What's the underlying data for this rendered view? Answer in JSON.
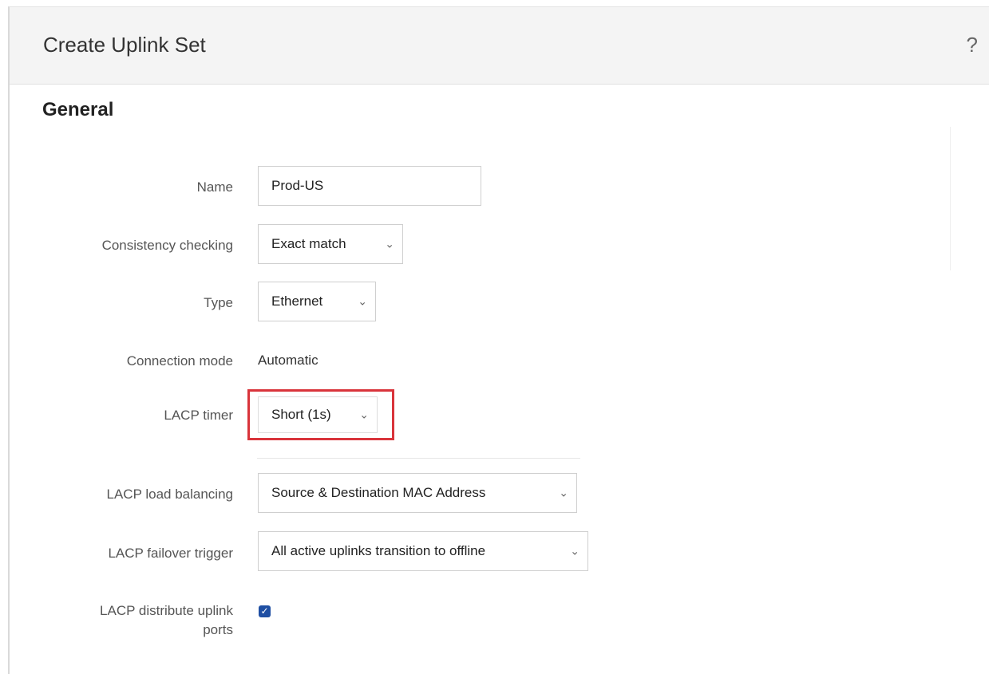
{
  "dialog": {
    "title": "Create Uplink Set",
    "help_label": "?"
  },
  "section": {
    "title": "General"
  },
  "form": {
    "name": {
      "label": "Name",
      "value": "Prod-US"
    },
    "consistency_checking": {
      "label": "Consistency checking",
      "value": "Exact match"
    },
    "type": {
      "label": "Type",
      "value": "Ethernet"
    },
    "connection_mode": {
      "label": "Connection mode",
      "value": "Automatic"
    },
    "lacp_timer": {
      "label": "LACP timer",
      "value": "Short (1s)"
    },
    "lacp_load_balancing": {
      "label": "LACP load balancing",
      "value": "Source & Destination MAC Address"
    },
    "lacp_failover_trigger": {
      "label": "LACP failover trigger",
      "value": "All active uplinks transition to offline"
    },
    "lacp_distribute_uplink_ports": {
      "label_line1": "LACP distribute uplink",
      "label_line2": "ports",
      "checked": true
    }
  },
  "icons": {
    "chevron": "chevron-down-icon",
    "check": "checkmark-icon"
  },
  "colors": {
    "highlight": "#d9343b",
    "checkbox": "#1f4fa3",
    "header_bg": "#f4f4f4"
  }
}
